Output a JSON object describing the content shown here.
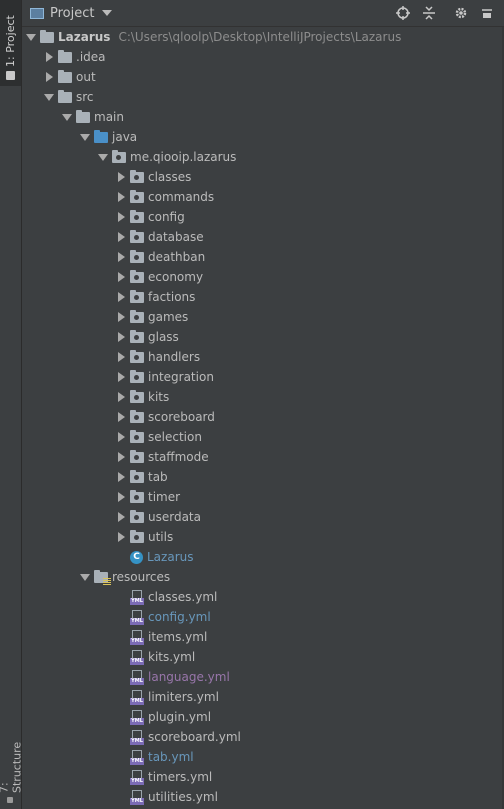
{
  "sidebar": {
    "project_tab": "1: Project",
    "structure_tab": "7: Structure"
  },
  "header": {
    "title": "Project"
  },
  "tree": {
    "root": {
      "name": "Lazarus",
      "path": "C:\\Users\\qloolp\\Desktop\\IntelliJProjects\\Lazarus"
    },
    "idea": ".idea",
    "out": "out",
    "src": "src",
    "main": "main",
    "java": "java",
    "package": "me.qiooip.lazarus",
    "packages": [
      "classes",
      "commands",
      "config",
      "database",
      "deathban",
      "economy",
      "factions",
      "games",
      "glass",
      "handlers",
      "integration",
      "kits",
      "scoreboard",
      "selection",
      "staffmode",
      "tab",
      "timer",
      "userdata",
      "utils"
    ],
    "main_class": "Lazarus",
    "resources": "resources",
    "yml_files": [
      {
        "name": "classes.yml",
        "modified": ""
      },
      {
        "name": "config.yml",
        "modified": "blue"
      },
      {
        "name": "items.yml",
        "modified": ""
      },
      {
        "name": "kits.yml",
        "modified": ""
      },
      {
        "name": "language.yml",
        "modified": "purple"
      },
      {
        "name": "limiters.yml",
        "modified": ""
      },
      {
        "name": "plugin.yml",
        "modified": ""
      },
      {
        "name": "scoreboard.yml",
        "modified": ""
      },
      {
        "name": "tab.yml",
        "modified": "blue"
      },
      {
        "name": "timers.yml",
        "modified": ""
      },
      {
        "name": "utilities.yml",
        "modified": ""
      }
    ]
  },
  "colors": {
    "background": "#3c3f41",
    "text": "#bbbbbb",
    "modified_blue": "#6897bb",
    "modified_purple": "#9876aa"
  }
}
